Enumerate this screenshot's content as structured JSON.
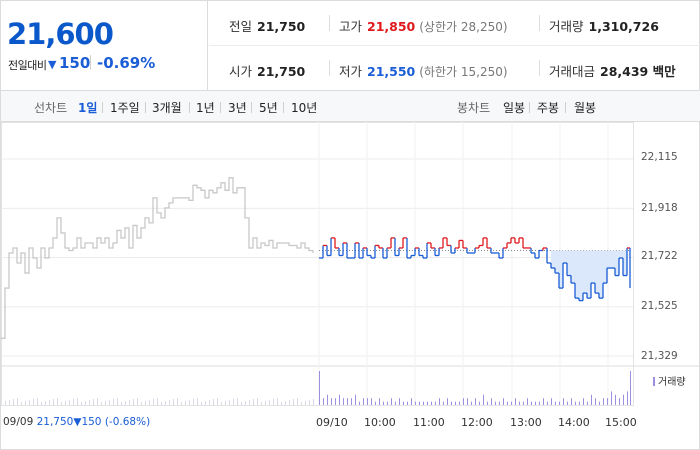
{
  "summary": {
    "current_price": "21,600",
    "change_label": "전일대비",
    "change_arrow": "▼",
    "change_value": "150",
    "change_percent": "-0.69%",
    "stats": {
      "prev_close_label": "전일",
      "prev_close": "21,750",
      "high_label": "고가",
      "high": "21,850",
      "upper_limit": "(상한가 28,250)",
      "volume_label": "거래량",
      "volume": "1,310,726",
      "open_label": "시가",
      "open": "21,750",
      "low_label": "저가",
      "low": "21,550",
      "lower_limit": "(하한가 15,250)",
      "value_label": "거래대금",
      "value": "28,439 백만"
    },
    "colors": {
      "up": "#e0191d",
      "down": "#1a5dd6",
      "price": "#0a58ca"
    }
  },
  "toolbar": {
    "line_chart_label": "선차트",
    "periods": [
      "1일",
      "1주일",
      "3개월",
      "1년",
      "3년",
      "5년",
      "10년"
    ],
    "active_period": "1일",
    "candle_label": "봉차트",
    "candles": [
      "일봉",
      "주봉",
      "월봉"
    ]
  },
  "chart_data": {
    "type": "line",
    "title": "",
    "ylim": [
      21329,
      22115
    ],
    "yticks": [
      "22,115",
      "21,918",
      "21,722",
      "21,525",
      "21,329"
    ],
    "xticks": [
      "09/09",
      "09/10",
      "10:00",
      "11:00",
      "12:00",
      "13:00",
      "14:00",
      "15:00"
    ],
    "reference_line": 21750,
    "prev_day_summary": {
      "date": "09/09",
      "close": "21,750",
      "arrow": "▼",
      "change": "150",
      "percent": "(-0.68%)"
    },
    "volume_legend": "거래량",
    "series": [
      {
        "color": "#c8c8c8",
        "x": [
          0,
          4,
          8,
          12,
          16,
          20,
          24,
          28,
          32,
          36,
          40,
          44,
          48,
          52,
          56,
          60,
          64,
          68,
          72,
          76,
          80,
          84,
          88,
          92,
          96,
          100,
          104,
          108,
          112,
          116,
          120,
          124,
          128,
          132,
          136,
          140,
          144,
          148,
          152,
          156,
          160,
          164,
          168,
          172,
          176,
          180,
          184,
          188,
          192,
          196,
          200,
          204,
          208,
          212,
          216,
          220,
          224,
          228,
          232,
          236,
          240,
          244,
          248,
          252,
          256,
          260,
          264,
          268,
          272,
          276,
          280,
          284,
          288,
          292,
          296,
          300,
          304,
          308,
          312
        ],
        "values": [
          21400,
          21600,
          21740,
          21760,
          21700,
          21740,
          21660,
          21760,
          21720,
          21680,
          21760,
          21720,
          21760,
          21800,
          21880,
          21820,
          21760,
          21750,
          21760,
          21800,
          21760,
          21780,
          21780,
          21760,
          21800,
          21780,
          21800,
          21760,
          21780,
          21830,
          21800,
          21840,
          21760,
          21850,
          21800,
          21840,
          21880,
          21860,
          21960,
          21900,
          21880,
          21920,
          21940,
          21960,
          21960,
          21960,
          21960,
          21950,
          22010,
          22000,
          21990,
          21960,
          21990,
          21980,
          22000,
          22020,
          21990,
          22040,
          21980,
          22000,
          22000,
          21880,
          21760,
          21800,
          21760,
          21780,
          21770,
          21790,
          21760,
          21780,
          21780,
          21780,
          21770,
          21770,
          21760,
          21780,
          21760,
          21750,
          21740
        ]
      },
      {
        "color": "#e0191d",
        "color_below": "#1a5dd6",
        "x": [
          318,
          322,
          326,
          330,
          334,
          338,
          342,
          346,
          350,
          354,
          358,
          362,
          366,
          370,
          374,
          378,
          382,
          386,
          390,
          394,
          398,
          402,
          406,
          410,
          414,
          418,
          422,
          426,
          430,
          434,
          438,
          442,
          446,
          450,
          454,
          458,
          462,
          466,
          470,
          474,
          478,
          482,
          486,
          490,
          494,
          498,
          502,
          506,
          510,
          514,
          518,
          522,
          526,
          530,
          534,
          538,
          542,
          546,
          550,
          554,
          558,
          562,
          566,
          570,
          574,
          578,
          582,
          586,
          590,
          594,
          598,
          602,
          606,
          610,
          614,
          618,
          622,
          626,
          629
        ],
        "values": [
          21720,
          21770,
          21730,
          21800,
          21760,
          21730,
          21780,
          21720,
          21720,
          21780,
          21720,
          21760,
          21730,
          21720,
          21770,
          21760,
          21720,
          21760,
          21800,
          21730,
          21760,
          21800,
          21720,
          21730,
          21760,
          21730,
          21720,
          21780,
          21760,
          21730,
          21760,
          21800,
          21770,
          21740,
          21760,
          21790,
          21760,
          21740,
          21740,
          21760,
          21770,
          21800,
          21760,
          21740,
          21740,
          21720,
          21760,
          21780,
          21800,
          21780,
          21800,
          21760,
          21760,
          21740,
          21720,
          21750,
          21760,
          21700,
          21680,
          21660,
          21600,
          21700,
          21650,
          21620,
          21560,
          21550,
          21580,
          21560,
          21620,
          21580,
          21560,
          21620,
          21680,
          21680,
          21650,
          21720,
          21650,
          21760,
          21600
        ]
      }
    ],
    "volume": {
      "color": "#9c8fe0",
      "note": "intraday volume bars (relative scale)",
      "values": [
        1,
        0.2,
        0.3,
        0.2,
        0.2,
        0.3,
        0.2,
        0.2,
        0.2,
        0.3,
        0.1,
        0.2,
        0.2,
        0.2,
        0.1,
        0.2,
        0.1,
        0.1,
        0.2,
        0.1,
        0.2,
        0.1,
        0.1,
        0.2,
        0.1,
        0.1,
        0.1,
        0.1,
        0.1,
        0.1,
        0.2,
        0.1,
        0.2,
        0.1,
        0.1,
        0.1,
        0.2,
        0.2,
        0.1,
        0.2,
        0.1,
        0.3,
        0.1,
        0.2,
        0.1,
        0.1,
        0.2,
        0.1,
        0.1,
        0.2,
        0.1,
        0.1,
        0.2,
        0.1,
        0.1,
        0.1,
        0.2,
        0.1,
        0.2,
        0.1,
        0.1,
        0.2,
        0.1,
        0.2,
        0.1,
        0.1,
        0.2,
        0.1,
        0.3,
        0.2,
        0.1,
        0.2,
        0.2,
        0.4,
        0.3,
        0.2,
        0.3,
        0.4,
        1
      ]
    }
  }
}
